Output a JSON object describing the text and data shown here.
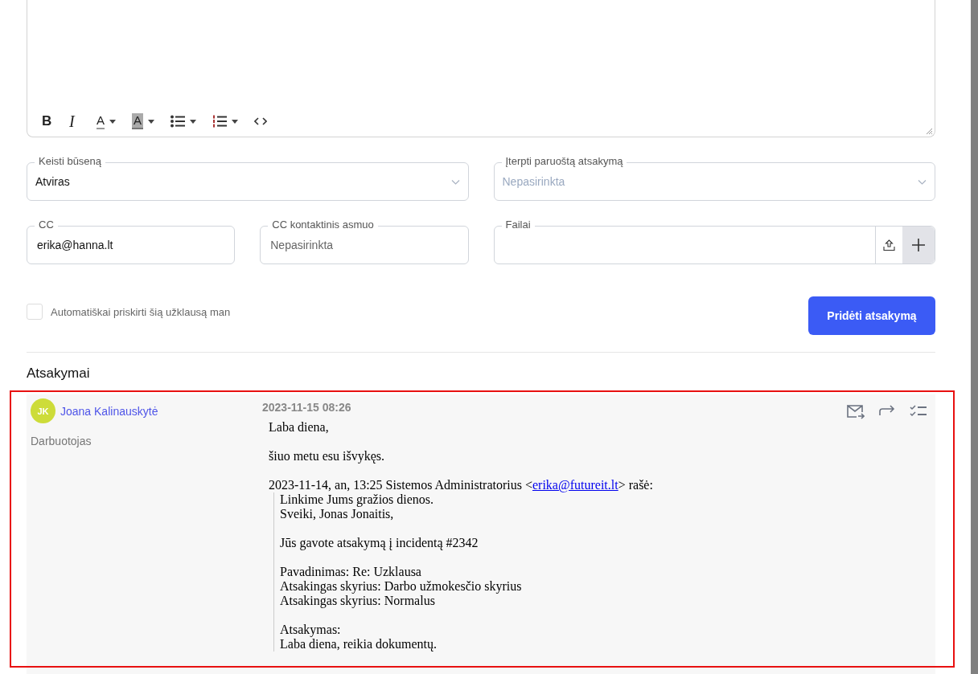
{
  "editor": {
    "toolbar": [
      {
        "kind": "bold",
        "label": "B"
      },
      {
        "kind": "italic",
        "label": "I"
      },
      {
        "kind": "text-color",
        "label": "A"
      },
      {
        "kind": "highlight",
        "label": "A"
      },
      {
        "kind": "bullet-list"
      },
      {
        "kind": "numbered-list"
      },
      {
        "kind": "code"
      }
    ]
  },
  "fields": [
    {
      "kind": "select",
      "label": "Keisti būseną",
      "value": "Atviras"
    },
    {
      "kind": "select",
      "label": "Įterpti paruoštą atsakymą",
      "placeholder": "Nepasirinkta"
    },
    {
      "kind": "input",
      "label": "CC",
      "value": "erika@hanna.lt"
    },
    {
      "kind": "input",
      "label": "CC kontaktinis asmuo",
      "placeholder": "Nepasirinkta"
    },
    {
      "kind": "file",
      "label": "Failai"
    }
  ],
  "auto_assign": {
    "label": "Automatiškai priskirti šią užklausą man",
    "checked": false
  },
  "submit_button": "Pridėti atsakymą",
  "replies_title": "Atsakymai",
  "replies": [
    {
      "initials": "JK",
      "author": "Joana Kalinauskytė",
      "role": "Darbuotojas",
      "date": "2023-11-15 08:26",
      "body": [
        "Laba diena,",
        "šiuo metu esu išvykęs."
      ],
      "quote_header": {
        "before": "2023-11-14, an, 13:25 Sistemos Administratorius <",
        "link": "erika@futureit.lt",
        "after": "> rašė:"
      },
      "quote": [
        [
          "Linkime Jums gražios dienos.",
          "Sveiki, Jonas Jonaitis,"
        ],
        [
          "Jūs gavote atsakymą į incidentą #2342"
        ],
        [
          "Pavadinimas: Re: Uzklausa",
          "Atsakingas skyrius: Darbo užmokesčio skyrius",
          "Atsakingas skyrius: Normalus"
        ],
        [
          "Atsakymas:",
          "Laba diena, reikia dokumentų."
        ]
      ]
    }
  ]
}
